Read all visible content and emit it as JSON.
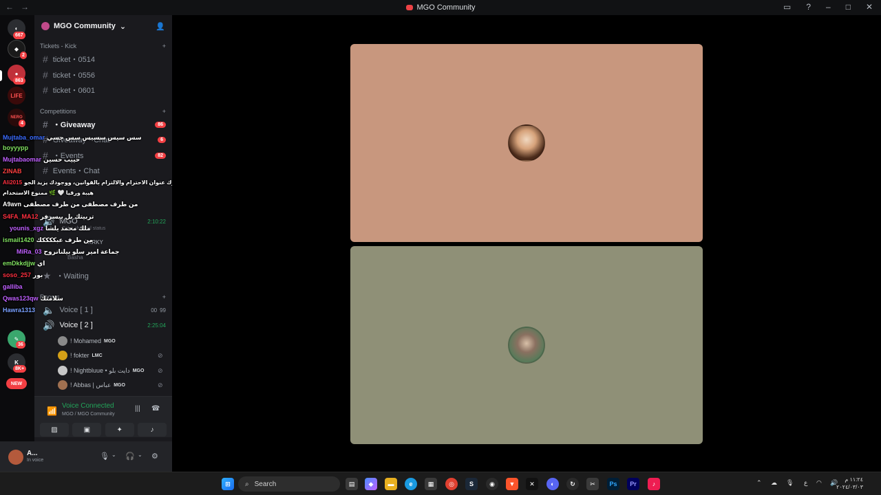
{
  "window": {
    "title": "MGO Community"
  },
  "servers": [
    {
      "badge": "667"
    },
    {
      "badge": "2"
    },
    {
      "badge": "863"
    },
    {
      "label": "LIFE"
    },
    {
      "label": "NERO",
      "badge": "4"
    },
    {
      "badge": "36"
    },
    {
      "badge": "8K+"
    },
    {
      "label": "NEW"
    }
  ],
  "server_header": {
    "name": "MGO Community"
  },
  "categories": {
    "tickets": "Tickets - Kick",
    "competitions": "Competitions",
    "rooms": "Rooms"
  },
  "channels": {
    "ticket_0514": "ticket・0514",
    "ticket_0556": "ticket・0556",
    "ticket_0601": "ticket・0601",
    "giveaway": "・Giveaway",
    "giveaway_count": "86",
    "giveaway_chat": "Giveaway・Chat",
    "giveaway_chat_count": "6",
    "events": "・Events",
    "events_count": "82",
    "events_chat": "Events・Chat",
    "mgo": "MGO",
    "mgo_time": "2:10:22",
    "status_placeholder": "Set a channel status",
    "krky": "KRKY",
    "basha": "Basha",
    "waiting": "・Waiting",
    "voice1": "Voice [ 1 ]",
    "voice1_count_a": "00",
    "voice1_count_b": "99",
    "voice2": "Voice [ 2 ]",
    "voice2_time": "2:25:04"
  },
  "members": [
    {
      "name": "! Mohamed",
      "tag": "MGO",
      "color": "#8a8a8a"
    },
    {
      "name": "! fokter",
      "tag": "LMC",
      "color": "#d4a017"
    },
    {
      "name": "! Nightbluue • دايت بلو",
      "tag": "MGO",
      "color": "#c7c7c7"
    },
    {
      "name": "! Abbas | عباس",
      "tag": "MGO",
      "color": "#a07050"
    }
  ],
  "chat_overlay": [
    {
      "name": "Mujtaba_omar",
      "msg": "سس سيس سسيس سس جسي",
      "color": "#3b6cff"
    },
    {
      "name": "boyyypp",
      "msg": "",
      "color": "#80e060"
    },
    {
      "name": "Mujtabaomar",
      "msg": "حييب حسين",
      "color": "#c060ff"
    },
    {
      "name": "ZINAB",
      "msg": "",
      "color": "#ff4040"
    },
    {
      "name": "Ali2015",
      "msg": "وعليكم السلام ✨ نورت\\ي جات،حضورك عنوان الاحترام والالتزام بالقوانين، ووجودك يزيد الجو",
      "color": "#ff3040"
    },
    {
      "name": "",
      "msg": "هيبة ورقيا 🤍 🌿 ممنوع الاستخدام",
      "color": "#ffffff"
    },
    {
      "name": "A9avn",
      "msg": "من طرف مصطفى من طرف مصطفى",
      "color": "#ffffff"
    },
    {
      "name": "S4FA_MA12",
      "msg": "تربيتك بل بيسرفر",
      "color": "#ff3040"
    },
    {
      "name": "younis_xgz",
      "msg": "ملك محمد يلشا",
      "color": "#c060ff"
    },
    {
      "name": "ismail1420",
      "msg": "من طرف عبككككك",
      "color": "#80e060"
    },
    {
      "name": "MiRa_03",
      "msg": "جماعة امير سلو بيلنانروح",
      "color": "#c060ff"
    },
    {
      "name": "emDkkdjjw",
      "msg": "اي",
      "color": "#80e060"
    },
    {
      "name": "soso_257",
      "msg": "بور",
      "color": "#ff3040"
    },
    {
      "name": "galliba",
      "msg": "",
      "color": "#c060ff"
    },
    {
      "name": "Qwas123qw",
      "msg": "سلامتك",
      "color": "#c060ff"
    },
    {
      "name": "Hawra1313",
      "msg": "",
      "color": "#7aa0ff"
    }
  ],
  "voice_panel": {
    "status": "Voice Connected",
    "location": "MGO / MGO Community"
  },
  "user": {
    "name": "A...",
    "status": "In voice"
  },
  "tiles": [
    {
      "bg": "#c8977e",
      "avatar": "#8a4a2a"
    },
    {
      "bg": "#8f9077",
      "avatar": "#5a6a5a"
    }
  ],
  "taskbar": {
    "search_label": "Search",
    "lang": "ع",
    "time": "١١:٢٤ م",
    "date": "٢٠٢٤/٠٣/٠٣"
  }
}
